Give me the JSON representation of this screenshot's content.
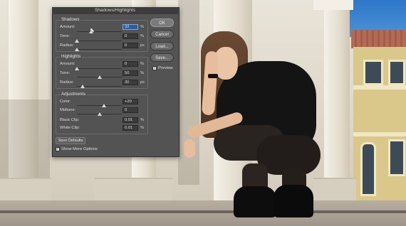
{
  "dialog": {
    "title": "Shadows/Highlights",
    "buttons": {
      "ok": "OK",
      "cancel": "Cancel",
      "load": "Load...",
      "save": "Save..."
    },
    "preview": {
      "label": "Preview",
      "checked": true
    },
    "shadows": {
      "title": "Shadows",
      "amount": {
        "label": "Amount:",
        "value": "32",
        "unit": "%",
        "level": 0.32
      },
      "tone": {
        "label": "Tone:",
        "value": "0",
        "unit": "%",
        "level": 0.0
      },
      "radius": {
        "label": "Radius:",
        "value": "0",
        "unit": "px",
        "level": 0.0
      }
    },
    "highlights": {
      "title": "Highlights",
      "amount": {
        "label": "Amount:",
        "value": "0",
        "unit": "%",
        "level": 0.0
      },
      "tone": {
        "label": "Tone:",
        "value": "50",
        "unit": "%",
        "level": 0.5
      },
      "radius": {
        "label": "Radius:",
        "value": "30",
        "unit": "px",
        "level": 0.12
      }
    },
    "adjustments": {
      "title": "Adjustments",
      "color": {
        "label": "Color:",
        "value": "+20",
        "level": 0.6
      },
      "midtone": {
        "label": "Midtone:",
        "value": "0",
        "level": 0.5
      },
      "black_clip": {
        "label": "Black Clip:",
        "value": "0.01",
        "unit": "%"
      },
      "white_clip": {
        "label": "White Clip:",
        "value": "0.01",
        "unit": "%"
      }
    },
    "save_defaults": "Save Defaults",
    "show_more_options": {
      "label": "Show More Options",
      "checked": true
    }
  }
}
